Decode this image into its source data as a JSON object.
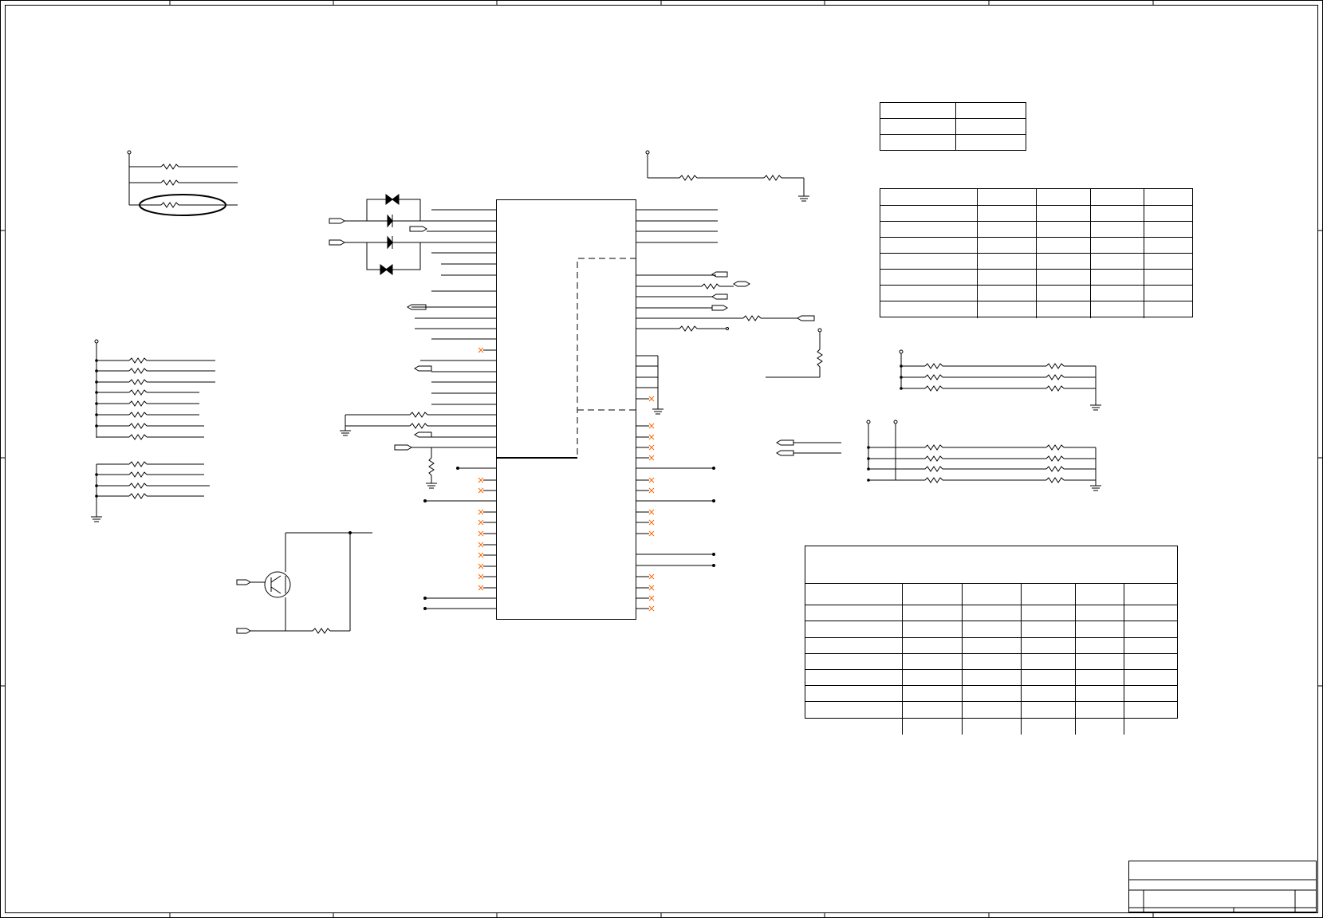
{
  "sheet": {
    "title_block": {
      "title": "",
      "sheet_name": "",
      "revision": "",
      "sheet_number": ""
    }
  },
  "tables": [
    {
      "id": "strap-table",
      "rows": 3,
      "cols": 2
    },
    {
      "id": "config-table",
      "rows": 8,
      "cols": 5
    },
    {
      "id": "pin-table",
      "rows": 9,
      "cols": 6,
      "has_title_row": true
    }
  ],
  "colors": {
    "line": "#000000",
    "no_connect": "#ff6600",
    "background": "#ffffff"
  }
}
